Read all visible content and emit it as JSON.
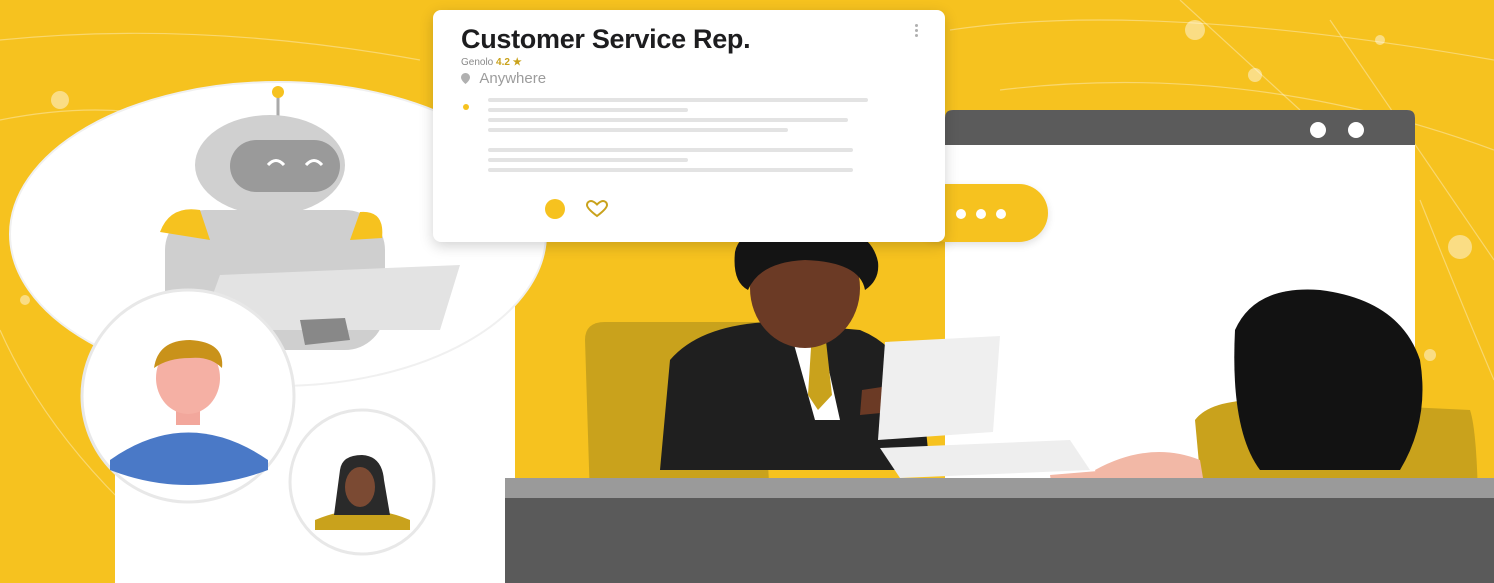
{
  "job_card": {
    "title": "Customer Service Rep.",
    "company": "Genolo",
    "rating": "4.2 ★",
    "location": "Anywhere"
  },
  "icons": {
    "menu": "kebab-icon",
    "location": "pin-icon",
    "favorite": "heart-icon",
    "chat": "speech-bubble-icon"
  },
  "colors": {
    "background": "#f6c21f",
    "accent": "#f6c21f",
    "dark": "#1d1d1f",
    "gray": "#5a5a5a"
  }
}
